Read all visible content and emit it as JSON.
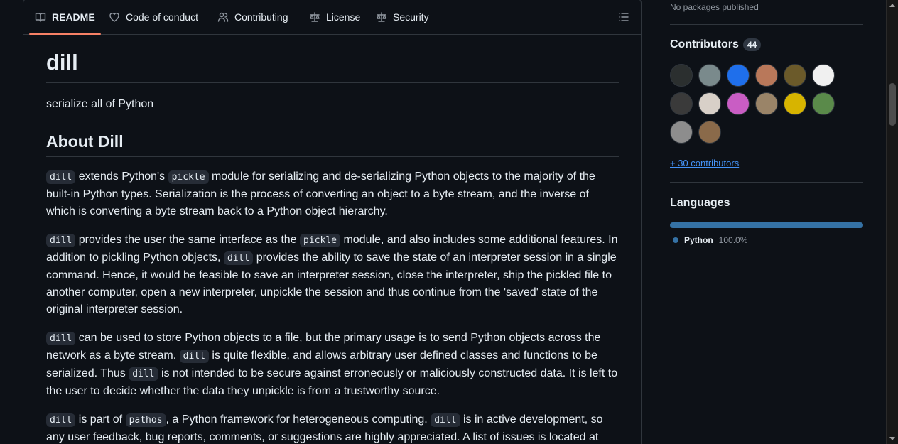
{
  "tabs": [
    {
      "label": "README",
      "icon": "book-icon",
      "active": true
    },
    {
      "label": "Code of conduct",
      "icon": "heart-icon"
    },
    {
      "label": "Contributing",
      "icon": "people-icon"
    },
    {
      "label": "License",
      "icon": "law-icon"
    },
    {
      "label": "Security",
      "icon": "law-icon"
    }
  ],
  "readme": {
    "title": "dill",
    "tagline": "serialize all of Python",
    "about_heading": "About Dill",
    "p1": {
      "c1": "dill",
      "t1": " extends Python's ",
      "c2": "pickle",
      "t2": " module for serializing and de-serializing Python objects to the majority of the built-in Python types. Serialization is the process of converting an object to a byte stream, and the inverse of which is converting a byte stream back to a Python object hierarchy."
    },
    "p2": {
      "c1": "dill",
      "t1": " provides the user the same interface as the ",
      "c2": "pickle",
      "t2": " module, and also includes some additional features. In addition to pickling Python objects, ",
      "c3": "dill",
      "t3": " provides the ability to save the state of an interpreter session in a single command. Hence, it would be feasible to save an interpreter session, close the interpreter, ship the pickled file to another computer, open a new interpreter, unpickle the session and thus continue from the 'saved' state of the original interpreter session."
    },
    "p3": {
      "c1": "dill",
      "t1": " can be used to store Python objects to a file, but the primary usage is to send Python objects across the network as a byte stream. ",
      "c2": "dill",
      "t2": " is quite flexible, and allows arbitrary user defined classes and functions to be serialized. Thus ",
      "c3": "dill",
      "t3": " is not intended to be secure against erroneously or maliciously constructed data. It is left to the user to decide whether the data they unpickle is from a trustworthy source."
    },
    "p4": {
      "c1": "dill",
      "t1": " is part of ",
      "c2": "pathos",
      "t2": ", a Python framework for heterogeneous computing. ",
      "c3": "dill",
      "t3": " is in active development, so any user feedback, bug reports, comments, or suggestions are highly appreciated. A list of issues is located at"
    }
  },
  "sidebar": {
    "packages_text": "No packages published",
    "contributors_title": "Contributors",
    "contributors_count": "44",
    "more_contributors": "+ 30 contributors",
    "languages_title": "Languages",
    "language_name": "Python",
    "language_percent": "100.0%",
    "language_color": "#3572a5"
  },
  "avatars": [
    {
      "name": "avatar-1",
      "bg": "#2b2f2f"
    },
    {
      "name": "avatar-2",
      "bg": "#7a8a8c"
    },
    {
      "name": "avatar-3",
      "bg": "#1f6feb"
    },
    {
      "name": "avatar-4",
      "bg": "#b9785a"
    },
    {
      "name": "avatar-5",
      "bg": "#6b5a2a"
    },
    {
      "name": "avatar-6",
      "bg": "#f0f0f0"
    },
    {
      "name": "avatar-7",
      "bg": "#3a3a3a"
    },
    {
      "name": "avatar-8",
      "bg": "#d8d0c8"
    },
    {
      "name": "avatar-9",
      "bg": "#c95dc4"
    },
    {
      "name": "avatar-10",
      "bg": "#9a8468"
    },
    {
      "name": "avatar-11",
      "bg": "#d7b400"
    },
    {
      "name": "avatar-12",
      "bg": "#5a8a4a"
    },
    {
      "name": "avatar-13",
      "bg": "#8d8d8d"
    },
    {
      "name": "avatar-14",
      "bg": "#8a6a4a"
    }
  ]
}
